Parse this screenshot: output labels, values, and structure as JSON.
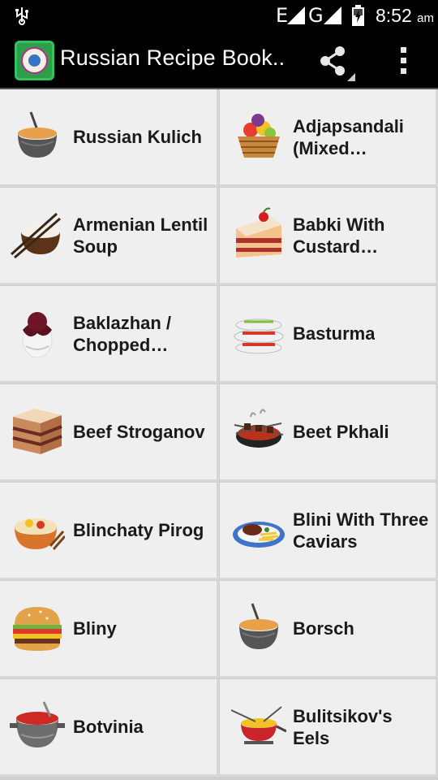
{
  "status_bar": {
    "network_e": "E",
    "network_g": "G",
    "time": "8:52",
    "ampm": "am"
  },
  "app_bar": {
    "title": "Russian Recipe Book..",
    "share_icon": "share-icon",
    "menu_icon": "overflow-menu-icon"
  },
  "recipes": [
    {
      "title": "Russian Kulich",
      "icon": "soup-pot-icon"
    },
    {
      "title": "Adjapsandali (Mixed…",
      "icon": "fruit-basket-icon"
    },
    {
      "title": "Armenian Lentil Soup",
      "icon": "rice-bowl-chopsticks-icon"
    },
    {
      "title": "Babki With Custard Filling…",
      "icon": "cake-slice-icon"
    },
    {
      "title": "Baklazhan / Chopped…",
      "icon": "chocolate-egg-icon"
    },
    {
      "title": "Basturma",
      "icon": "layered-platter-icon"
    },
    {
      "title": "Beef Stroganov",
      "icon": "layer-cake-icon"
    },
    {
      "title": "Beet Pkhali",
      "icon": "grill-skewers-icon"
    },
    {
      "title": "Blinchaty Pirog",
      "icon": "noodle-bowl-icon"
    },
    {
      "title": "Blini With Three Caviars",
      "icon": "steak-plate-icon"
    },
    {
      "title": "Bliny",
      "icon": "burger-icon"
    },
    {
      "title": "Borsch",
      "icon": "soup-pot-icon"
    },
    {
      "title": "Botvinia",
      "icon": "soup-cauldron-icon"
    },
    {
      "title": "Bulitsikov's Eels",
      "icon": "fondue-pot-icon"
    }
  ]
}
